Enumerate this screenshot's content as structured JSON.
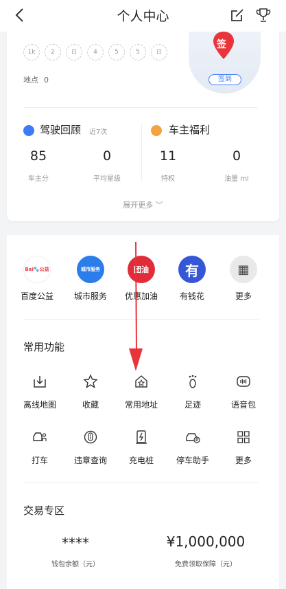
{
  "header": {
    "title": "个人中心"
  },
  "badges": [
    "1k",
    "2",
    "⊡",
    "4",
    "5",
    "5",
    "⊡"
  ],
  "places": {
    "label": "地点",
    "value": "0"
  },
  "checkin": {
    "pin_text": "签",
    "button": "签到"
  },
  "driving": {
    "title": "驾驶回顾",
    "subtitle": "近7次",
    "stats": [
      {
        "value": "85",
        "label": "车主分"
      },
      {
        "value": "0",
        "label": "平均星级"
      }
    ]
  },
  "owner": {
    "title": "车主福利",
    "stats": [
      {
        "value": "11",
        "label": "特权"
      },
      {
        "value": "0",
        "label": "油量 ml"
      }
    ]
  },
  "expand": "展开更多 ﹀",
  "services": [
    {
      "label": "百度公益",
      "icon_text": "Bai🐾公益"
    },
    {
      "label": "城市服务",
      "icon_text": "城市服务"
    },
    {
      "label": "优惠加油",
      "icon_text": "团油"
    },
    {
      "label": "有钱花",
      "icon_text": "有"
    },
    {
      "label": "更多",
      "icon_text": "▦"
    }
  ],
  "common": {
    "title": "常用功能",
    "items": [
      "离线地图",
      "收藏",
      "常用地址",
      "足迹",
      "语音包",
      "打车",
      "违章查询",
      "充电桩",
      "停车助手",
      "更多"
    ]
  },
  "trade": {
    "title": "交易专区",
    "wallet": {
      "value": "****",
      "label": "钱包余额（元）"
    },
    "guarantee": {
      "value": "¥1,000,000",
      "label": "免费领取保障（元）"
    }
  },
  "colors": {
    "accent": "#3d7cf7",
    "red": "#e8343a",
    "orange": "#f4a340"
  }
}
